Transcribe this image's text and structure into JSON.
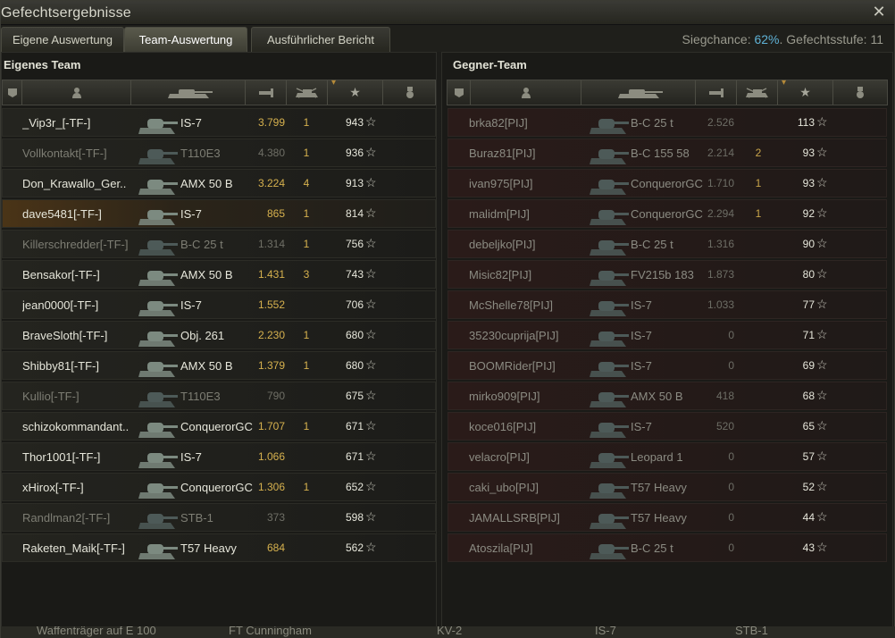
{
  "window": {
    "title": "Gefechtsergebnisse",
    "close_icon": "close-icon"
  },
  "tabs": [
    {
      "label": "Eigene Auswertung",
      "active": false
    },
    {
      "label": "Team-Auswertung",
      "active": true
    },
    {
      "label": "Ausführlicher Bericht",
      "active": false
    }
  ],
  "info": {
    "win_chance_label": "Siegchance: ",
    "win_chance_value": "62%",
    "tier_label": ". Gefechtsstufe: 11"
  },
  "own_team": {
    "title": "Eigenes Team",
    "players": [
      {
        "name": "_Vip3r_[-TF-]",
        "tank": "IS-7",
        "damage": "3.799",
        "kills": "1",
        "xp": "943",
        "alive": true,
        "highlight": false
      },
      {
        "name": "Vollkontakt[-TF-]",
        "tank": "T110E3",
        "damage": "4.380",
        "kills": "1",
        "xp": "936",
        "alive": false,
        "highlight": false
      },
      {
        "name": "Don_Krawallo_Ger..",
        "tank": "AMX 50 B",
        "damage": "3.224",
        "kills": "4",
        "xp": "913",
        "alive": true,
        "highlight": false
      },
      {
        "name": "dave5481[-TF-]",
        "tank": "IS-7",
        "damage": "865",
        "kills": "1",
        "xp": "814",
        "alive": true,
        "highlight": true
      },
      {
        "name": "Killerschredder[-TF-]",
        "tank": "B-C 25 t",
        "damage": "1.314",
        "kills": "1",
        "xp": "756",
        "alive": false,
        "highlight": false
      },
      {
        "name": "Bensakor[-TF-]",
        "tank": "AMX 50 B",
        "damage": "1.431",
        "kills": "3",
        "xp": "743",
        "alive": true,
        "highlight": false
      },
      {
        "name": "jean0000[-TF-]",
        "tank": "IS-7",
        "damage": "1.552",
        "kills": "",
        "xp": "706",
        "alive": true,
        "highlight": false
      },
      {
        "name": "BraveSloth[-TF-]",
        "tank": "Obj. 261",
        "damage": "2.230",
        "kills": "1",
        "xp": "680",
        "alive": true,
        "highlight": false
      },
      {
        "name": "Shibby81[-TF-]",
        "tank": "AMX 50 B",
        "damage": "1.379",
        "kills": "1",
        "xp": "680",
        "alive": true,
        "highlight": false
      },
      {
        "name": "Kullio[-TF-]",
        "tank": "T110E3",
        "damage": "790",
        "kills": "",
        "xp": "675",
        "alive": false,
        "highlight": false
      },
      {
        "name": "schizokommandant..",
        "tank": "ConquerorGC",
        "damage": "1.707",
        "kills": "1",
        "xp": "671",
        "alive": true,
        "highlight": false
      },
      {
        "name": "Thor1001[-TF-]",
        "tank": "IS-7",
        "damage": "1.066",
        "kills": "",
        "xp": "671",
        "alive": true,
        "highlight": false
      },
      {
        "name": "xHirox[-TF-]",
        "tank": "ConquerorGC",
        "damage": "1.306",
        "kills": "1",
        "xp": "652",
        "alive": true,
        "highlight": false
      },
      {
        "name": "Randlman2[-TF-]",
        "tank": "STB-1",
        "damage": "373",
        "kills": "",
        "xp": "598",
        "alive": false,
        "highlight": false
      },
      {
        "name": "Raketen_Maik[-TF-]",
        "tank": "T57 Heavy",
        "damage": "684",
        "kills": "",
        "xp": "562",
        "alive": true,
        "highlight": false
      }
    ]
  },
  "enemy_team": {
    "title": "Gegner-Team",
    "players": [
      {
        "name": "brka82[PIJ]",
        "tank": "B-C 25 t",
        "damage": "2.526",
        "kills": "",
        "xp": "113"
      },
      {
        "name": "Buraz81[PIJ]",
        "tank": "B-C 155 58",
        "damage": "2.214",
        "kills": "2",
        "xp": "93"
      },
      {
        "name": "ivan975[PIJ]",
        "tank": "ConquerorGC",
        "damage": "1.710",
        "kills": "1",
        "xp": "93"
      },
      {
        "name": "malidm[PIJ]",
        "tank": "ConquerorGC",
        "damage": "2.294",
        "kills": "1",
        "xp": "92"
      },
      {
        "name": "debeljko[PIJ]",
        "tank": "B-C 25 t",
        "damage": "1.316",
        "kills": "",
        "xp": "90"
      },
      {
        "name": "Misic82[PIJ]",
        "tank": "FV215b 183",
        "damage": "1.873",
        "kills": "",
        "xp": "80"
      },
      {
        "name": "McShelle78[PIJ]",
        "tank": "IS-7",
        "damage": "1.033",
        "kills": "",
        "xp": "77"
      },
      {
        "name": "35230cuprija[PIJ]",
        "tank": "IS-7",
        "damage": "0",
        "kills": "",
        "xp": "71"
      },
      {
        "name": "BOOMRider[PIJ]",
        "tank": "IS-7",
        "damage": "0",
        "kills": "",
        "xp": "69"
      },
      {
        "name": "mirko909[PIJ]",
        "tank": "AMX 50 B",
        "damage": "418",
        "kills": "",
        "xp": "68"
      },
      {
        "name": "koce016[PIJ]",
        "tank": "IS-7",
        "damage": "520",
        "kills": "",
        "xp": "65"
      },
      {
        "name": "velacro[PIJ]",
        "tank": "Leopard 1",
        "damage": "0",
        "kills": "",
        "xp": "57"
      },
      {
        "name": "caki_ubo[PIJ]",
        "tank": "T57 Heavy",
        "damage": "0",
        "kills": "",
        "xp": "52"
      },
      {
        "name": "JAMALLSRB[PIJ]",
        "tank": "T57 Heavy",
        "damage": "0",
        "kills": "",
        "xp": "44"
      },
      {
        "name": "Atoszila[PIJ]",
        "tank": "B-C 25 t",
        "damage": "0",
        "kills": "",
        "xp": "43"
      }
    ]
  },
  "columns": [
    "squad-icon",
    "player-icon",
    "tank-icon",
    "damage-icon",
    "kills-icon",
    "xp-star-icon",
    "medal-icon"
  ],
  "bottom_bar": [
    "Waffenträger auf E 100",
    "FT Cunningham",
    "KV-2",
    "IS-7",
    "STB-1"
  ]
}
